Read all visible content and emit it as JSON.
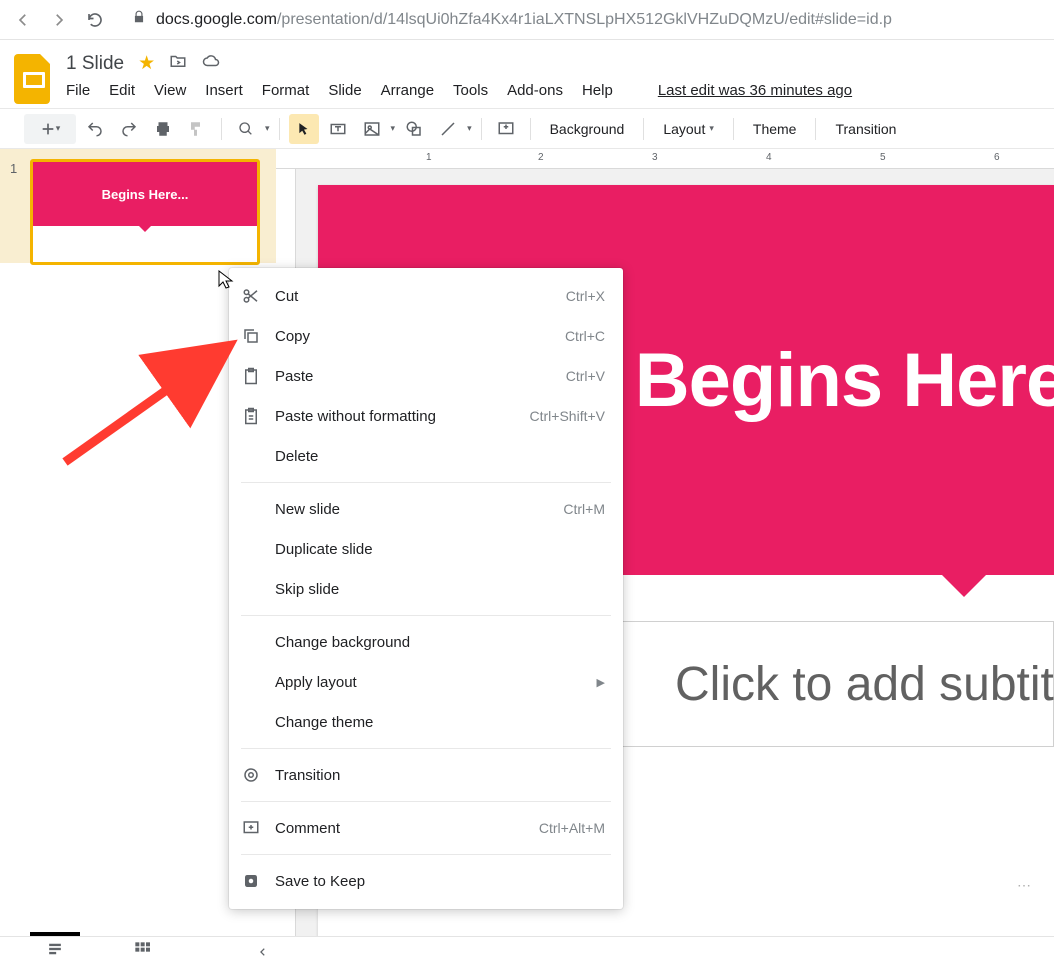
{
  "browser": {
    "url_host": "docs.google.com",
    "url_path": "/presentation/d/14lsqUi0hZfa4Kx4r1iaLXTNSLpHX512GklVHZuDQMzU/edit#slide=id.p"
  },
  "doc": {
    "title": "1 Slide",
    "last_edit": "Last edit was 36 minutes ago"
  },
  "menus": [
    "File",
    "Edit",
    "View",
    "Insert",
    "Format",
    "Slide",
    "Arrange",
    "Tools",
    "Add-ons",
    "Help"
  ],
  "toolbar": {
    "background": "Background",
    "layout": "Layout",
    "theme": "Theme",
    "transition": "Transition"
  },
  "ruler_ticks": [
    "1",
    "2",
    "3",
    "4",
    "5",
    "6"
  ],
  "thumbnail": {
    "number": "1",
    "title": "Begins Here..."
  },
  "slide": {
    "title": "Begins Here",
    "subtitle": "Click to add subtit"
  },
  "context_menu": {
    "items": [
      {
        "icon": "cut",
        "label": "Cut",
        "shortcut": "Ctrl+X"
      },
      {
        "icon": "copy",
        "label": "Copy",
        "shortcut": "Ctrl+C"
      },
      {
        "icon": "paste",
        "label": "Paste",
        "shortcut": "Ctrl+V"
      },
      {
        "icon": "paste-plain",
        "label": "Paste without formatting",
        "shortcut": "Ctrl+Shift+V"
      },
      {
        "icon": "",
        "label": "Delete",
        "shortcut": ""
      },
      {
        "sep": true
      },
      {
        "icon": "",
        "label": "New slide",
        "shortcut": "Ctrl+M"
      },
      {
        "icon": "",
        "label": "Duplicate slide",
        "shortcut": ""
      },
      {
        "icon": "",
        "label": "Skip slide",
        "shortcut": ""
      },
      {
        "sep": true
      },
      {
        "icon": "",
        "label": "Change background",
        "shortcut": ""
      },
      {
        "icon": "",
        "label": "Apply layout",
        "shortcut": "",
        "submenu": true
      },
      {
        "icon": "",
        "label": "Change theme",
        "shortcut": ""
      },
      {
        "sep": true
      },
      {
        "icon": "transition",
        "label": "Transition",
        "shortcut": ""
      },
      {
        "sep": true
      },
      {
        "icon": "comment",
        "label": "Comment",
        "shortcut": "Ctrl+Alt+M"
      },
      {
        "sep": true
      },
      {
        "icon": "keep",
        "label": "Save to Keep",
        "shortcut": ""
      }
    ]
  }
}
